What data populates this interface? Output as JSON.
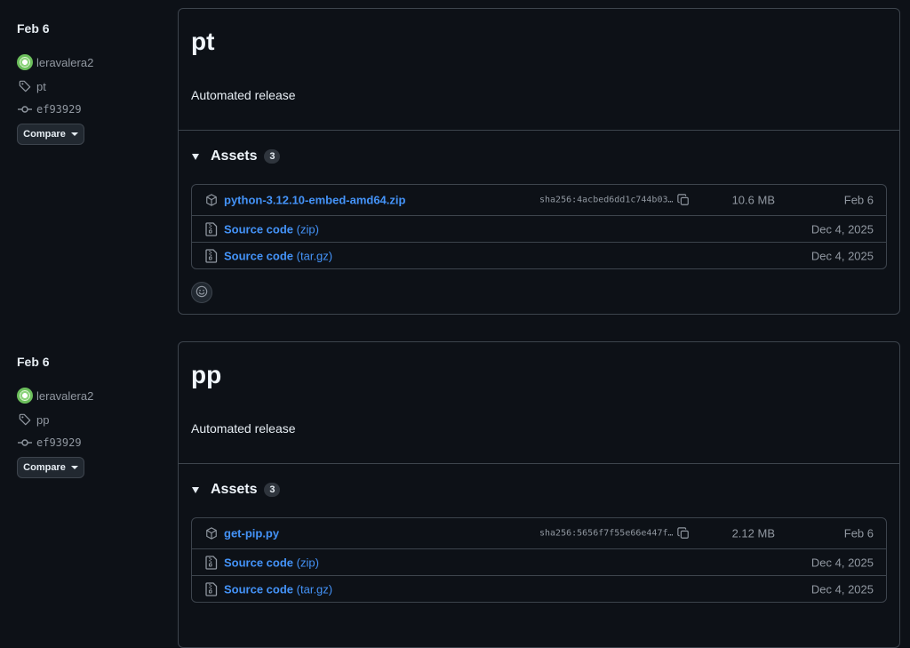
{
  "releases": [
    {
      "date": "Feb 6",
      "author": "leravalera2",
      "tag": "pt",
      "commit": "ef93929",
      "compare_label": "Compare",
      "title": "pt",
      "description": "Automated release",
      "assets_label": "Assets",
      "assets_count": "3",
      "assets": [
        {
          "name": "python-3.12.10-embed-amd64.zip",
          "sha": "sha256:4acbed6dd1c744b03…",
          "size": "10.6 MB",
          "date": "Feb 6"
        },
        {
          "name": "Source code",
          "suffix": "(zip)",
          "date": "Dec 4, 2025"
        },
        {
          "name": "Source code",
          "suffix": "(tar.gz)",
          "date": "Dec 4, 2025"
        }
      ]
    },
    {
      "date": "Feb 6",
      "author": "leravalera2",
      "tag": "pp",
      "commit": "ef93929",
      "compare_label": "Compare",
      "title": "pp",
      "description": "Automated release",
      "assets_label": "Assets",
      "assets_count": "3",
      "assets": [
        {
          "name": "get-pip.py",
          "sha": "sha256:5656f7f55e66e447f…",
          "size": "2.12 MB",
          "date": "Feb 6"
        },
        {
          "name": "Source code",
          "suffix": "(zip)",
          "date": "Dec 4, 2025"
        },
        {
          "name": "Source code",
          "suffix": "(tar.gz)",
          "date": "Dec 4, 2025"
        }
      ]
    }
  ],
  "icons": {
    "avatar": "avatar",
    "tag": "tag-icon",
    "commit": "git-commit-icon",
    "package": "package-icon",
    "file_zip": "file-zip-icon",
    "copy": "copy-icon",
    "smiley": "smiley-icon"
  },
  "colors": {
    "background": "#0d1117",
    "border": "#3d444d",
    "link": "#4493f8",
    "muted": "#9198a1",
    "text": "#e6edf3"
  }
}
